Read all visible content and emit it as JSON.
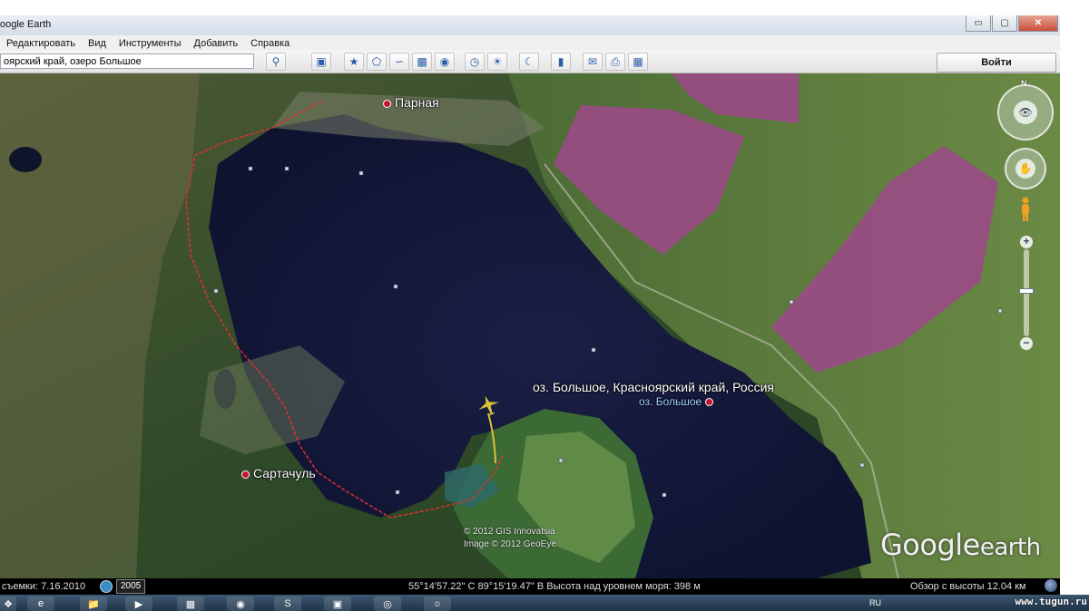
{
  "window": {
    "title": "oogle Earth",
    "buttons": {
      "minimize": "▭",
      "maximize": "▢",
      "close": "✕"
    }
  },
  "menu": [
    "Редактировать",
    "Вид",
    "Инструменты",
    "Добавить",
    "Справка"
  ],
  "search": {
    "value": "оярский край, озеро Большое"
  },
  "toolbar": {
    "icons": [
      "search-icon",
      "sidebar-icon",
      "placemark-icon",
      "polygon-icon",
      "path-icon",
      "overlay-icon",
      "tour-icon",
      "history-icon",
      "sun-icon",
      "planets-icon",
      "ruler-icon",
      "email-icon",
      "print-icon",
      "view-in-maps-icon"
    ],
    "login_label": "Войти"
  },
  "map": {
    "places": {
      "parnaya": "Парная",
      "sartachul": "Сартачуль",
      "lake_title": "оз. Большое, Красноярский край, Россия",
      "lake_name": "оз. Большое"
    },
    "copyright_1": "© 2012 GIS Innovatsia",
    "copyright_2": "Image © 2012 GeoEye",
    "logo_google": "Google",
    "logo_earth": "earth",
    "compass_north": "N",
    "colors": {
      "water": "#141a3a",
      "forest": "#2d4f2a",
      "field": "#5c7a3a",
      "pink_field": "#9a4a86",
      "track": "#e03030"
    }
  },
  "status": {
    "imagery_date": "съемки: 7.16.2010",
    "year": "2005",
    "coords": "55°14'57.22\" С   89°15'19.47\" В Высота над уровнем моря:   398 м",
    "eye_alt": "Обзор с высоты   12.04 км"
  },
  "taskbar": {
    "lang": "RU",
    "watermark": "www.tugun.ru"
  }
}
